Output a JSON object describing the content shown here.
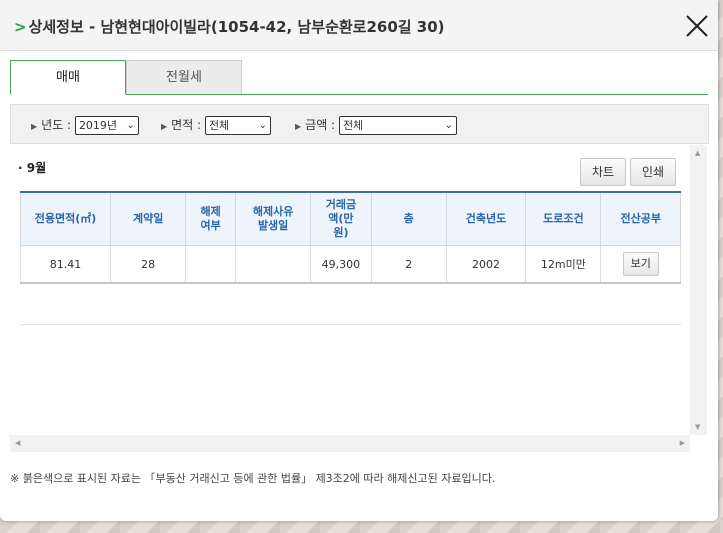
{
  "header": {
    "chevron": ">",
    "title": "상세정보 - 남현현대아이빌라(1054-42, 남부순환로260길 30)"
  },
  "tabs": [
    {
      "label": "매매",
      "active": true
    },
    {
      "label": "전월세",
      "active": false
    }
  ],
  "filters": {
    "year": {
      "label": "년도 :",
      "value": "2019년"
    },
    "area": {
      "label": "면적 :",
      "value": "전체"
    },
    "amount": {
      "label": "금액 :",
      "value": "전체"
    }
  },
  "content": {
    "month": "· 9월",
    "chart_button": "차트",
    "print_button": "인쇄",
    "table": {
      "headers": [
        "전용면적(㎡)",
        "계약일",
        "해제\n여부",
        "해제사유\n발생일",
        "거래금\n액(만\n원)",
        "층",
        "건축년도",
        "도로조건",
        "전산공부"
      ],
      "rows": [
        {
          "area": "81.41",
          "day": "28",
          "cancelled": "",
          "cancel_date": "",
          "price": "49,300",
          "floor": "2",
          "built": "2002",
          "road": "12m미만",
          "doc_button": "보기"
        }
      ]
    }
  },
  "note": "※ 붉은색으로 표시된 자료는 「부동산 거래신고 등에 관한 법률」 제3조2에 따라 해제신고된 자료입니다.",
  "colors": {
    "accent": "#4aa85a",
    "header_text": "#2a66a8",
    "table_border": "#3e6ea8"
  }
}
